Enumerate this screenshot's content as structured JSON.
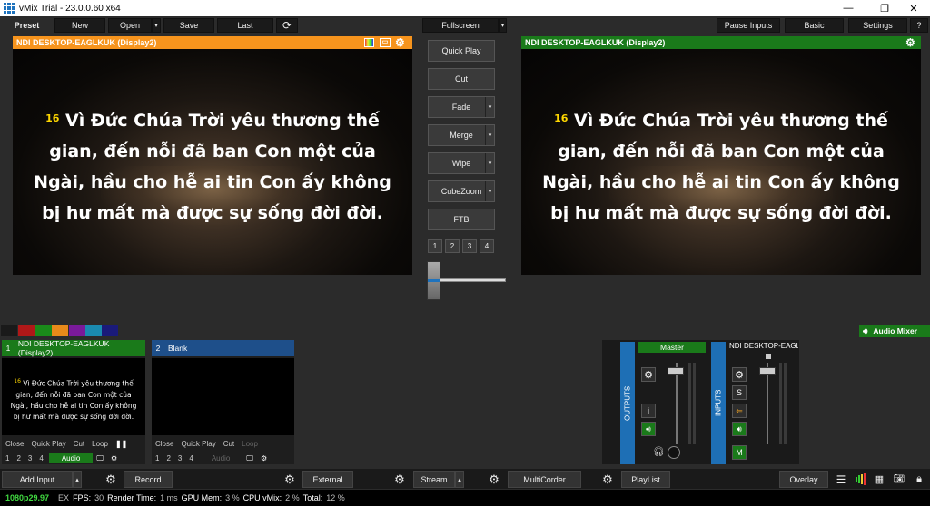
{
  "window": {
    "title": "vMix Trial - 23.0.0.60 x64",
    "minimize": "—",
    "restore": "❐",
    "close": "✕"
  },
  "topbar": {
    "preset": "Preset",
    "new": "New",
    "open": "Open",
    "save": "Save",
    "last": "Last",
    "fullscreen": "Fullscreen",
    "pause_inputs": "Pause Inputs",
    "basic": "Basic",
    "settings": "Settings",
    "help": "?"
  },
  "preview": {
    "title": "NDI DESKTOP-EAGLKUK (Display2)"
  },
  "output": {
    "title": "NDI DESKTOP-EAGLKUK (Display2)"
  },
  "scripture": {
    "verse_num": "16",
    "lines": [
      "Vì Đức Chúa Trời yêu thương thế",
      "gian, đến nỗi đã ban Con một của",
      "Ngài, hầu cho hễ ai tin Con ấy không",
      "bị hư mất mà được sự sống đời đời."
    ]
  },
  "transitions": {
    "quick_play": "Quick Play",
    "cut": "Cut",
    "fade": "Fade",
    "merge": "Merge",
    "wipe": "Wipe",
    "cubezoom": "CubeZoom",
    "ftb": "FTB",
    "numbers": [
      "1",
      "2",
      "3",
      "4"
    ]
  },
  "colors": {
    "preview_bar": "#f7941d",
    "output_bar": "#1a7a1a",
    "swatches": [
      "#1a1a1a",
      "#b01818",
      "#1a8a1a",
      "#e88a1a",
      "#7a1a9a",
      "#1a8ab0",
      "#1a1a7a"
    ]
  },
  "audio_mixer": {
    "label": "Audio Mixer",
    "master": "Master",
    "outputs": "OUTPUTS",
    "inputs": "INPUTS",
    "input_name": "NDI DESKTOP-EAGLKUK",
    "i_btn": "i",
    "s_btn": "S",
    "m_btn": "M"
  },
  "inputs": [
    {
      "num": "1",
      "name": "NDI DESKTOP-EAGLKUK (Display2)",
      "controls": [
        "Close",
        "Quick Play",
        "Cut",
        "Loop"
      ],
      "bottom": [
        "1",
        "2",
        "3",
        "4"
      ],
      "audio": "Audio"
    },
    {
      "num": "2",
      "name": "Blank",
      "controls": [
        "Close",
        "Quick Play",
        "Cut",
        "Loop"
      ],
      "bottom": [
        "1",
        "2",
        "3",
        "4"
      ],
      "audio": "Audio"
    }
  ],
  "bottombar": {
    "add_input": "Add Input",
    "record": "Record",
    "external": "External",
    "stream": "Stream",
    "multicorder": "MultiCorder",
    "playlist": "PlayList",
    "overlay": "Overlay"
  },
  "status": {
    "format": "1080p29.97",
    "ex": "EX",
    "fps_label": "FPS:",
    "fps": "30",
    "render_label": "Render Time:",
    "render": "1 ms",
    "gpu_label": "GPU Mem:",
    "gpu": "3 %",
    "cpu_label": "CPU vMix:",
    "cpu": "2 %",
    "total_label": "Total:",
    "total": "12 %"
  }
}
